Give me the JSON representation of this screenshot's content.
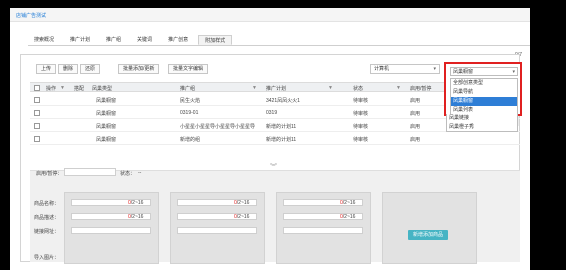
{
  "title": "店铺广告测试",
  "tabs": [
    "搜索概况",
    "推广计划",
    "推广组",
    "关键词",
    "推广创意",
    "附加样式"
  ],
  "active_tab": 5,
  "counter": "0/7",
  "toolbar": {
    "buttons": [
      "上传",
      "删除",
      "还原",
      "批量添加/更新",
      "批量文字编辑"
    ],
    "device": "计算机",
    "device_arrow": "▾"
  },
  "style_select": {
    "value": "凤巢橱窗",
    "arrow": "▾",
    "options": [
      "全部创意类型",
      "凤巢导航",
      "凤巢橱窗",
      "凤巢列表",
      "凤巢链接",
      "凤巢橙子秀"
    ],
    "selected_index": 2
  },
  "table": {
    "headers": {
      "ops": "操作",
      "draft": "搭配",
      "type": "凤巢类型",
      "group": "推广组",
      "plan": "推广计划",
      "status": "状态",
      "enable": "启用/暂停"
    },
    "rows": [
      {
        "type": "凤巢橱窗",
        "group": "民生火焰",
        "plan": "3421凤凤火火1",
        "status": "待审核",
        "enable": "启用"
      },
      {
        "type": "凤巢橱窗",
        "group": "0319-01",
        "plan": "0319",
        "status": "待审核",
        "enable": "启用"
      },
      {
        "type": "凤巢橱窗",
        "group": "小星星小星星导小星星导小星星导",
        "plan": "新增的计划11",
        "status": "待审核",
        "enable": "启用"
      },
      {
        "type": "凤巢橱窗",
        "group": "新增的组",
        "plan": "新增的计划11",
        "status": "待审核",
        "enable": "启用"
      }
    ]
  },
  "editor": {
    "enable_label": "启用/暂停：",
    "status_label": "状态：",
    "status_value": "--",
    "name_label": "商品名称：",
    "desc_label": "商品描述：",
    "url_label": "链接网址：",
    "image_label": "导入图片：",
    "count_zero": "0",
    "count_range": "/2~16",
    "add_button": "新增添加商品"
  },
  "icons": {
    "filter": "funnel-icon",
    "expand": "double-chevron-down-icon",
    "sort": "sort-icon"
  },
  "colors": {
    "link_blue": "#1e7bd6",
    "highlight_red": "#e02020",
    "selected_blue": "#2e7ed6",
    "add_button": "#46b4c4"
  }
}
